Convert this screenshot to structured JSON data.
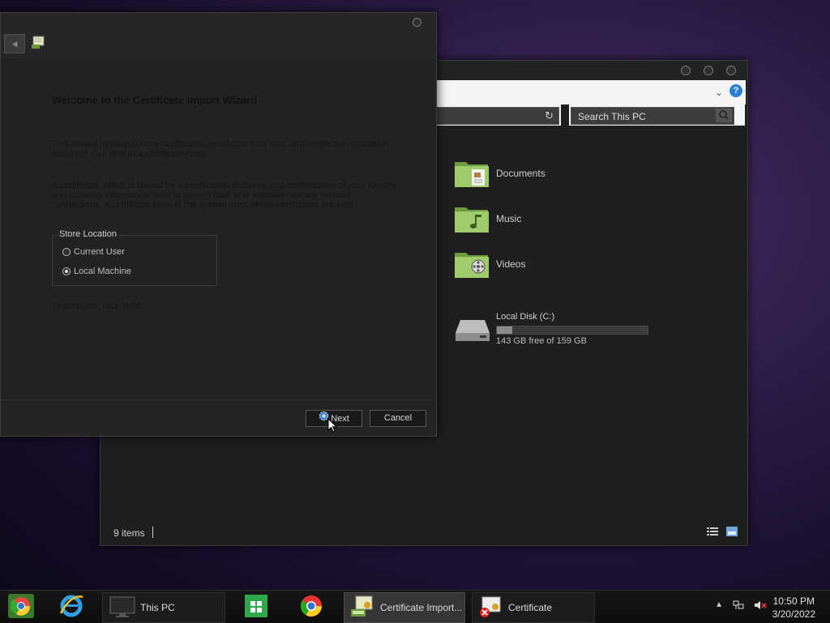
{
  "explorer": {
    "search_placeholder": "Search This PC",
    "help_label": "?",
    "folders": [
      {
        "label": "Documents",
        "icon": "documents-folder-icon"
      },
      {
        "label": "Music",
        "icon": "music-folder-icon"
      },
      {
        "label": "Videos",
        "icon": "videos-folder-icon"
      }
    ],
    "disk": {
      "name": "Local Disk (C:)",
      "free_text": "143 GB free of 159 GB",
      "used_fraction": 0.1
    },
    "status": {
      "item_count": "9 items"
    }
  },
  "wizard": {
    "title": "Welcome to the Certificate Import Wizard",
    "paragraph1": "This wizard helps you copy certificates, certificate trust lists, and certificate revocation lists from your disk to a certificate store.",
    "paragraph2": "A certificate, which is issued by a certification authority, is a confirmation of your identity and contains information used to protect data or to establish secure network connections. A certificate store is the system area where certificates are kept.",
    "store_location": {
      "legend": "Store Location",
      "options": [
        "Current User",
        "Local Machine"
      ],
      "selected": "Local Machine"
    },
    "continue_text": "To continue, click Next.",
    "next_label": "Next",
    "cancel_label": "Cancel"
  },
  "taskbar": {
    "this_pc": "This PC",
    "cert_import": "Certificate Import...",
    "certificate": "Certificate",
    "time": "10:50 PM",
    "date": "3/20/2022"
  }
}
